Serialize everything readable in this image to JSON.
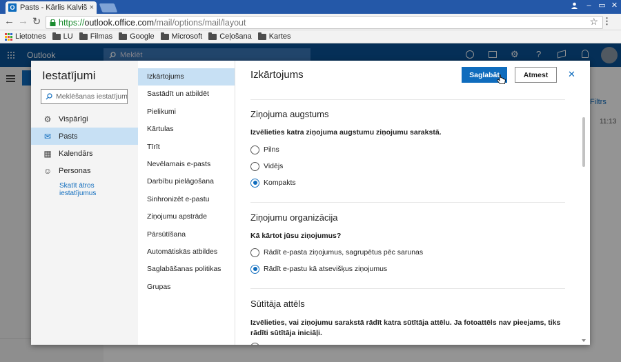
{
  "browser": {
    "tab_title": "Pasts - Kārlis Kalviški",
    "tab_close": "×",
    "url_scheme": "https://",
    "url_domain": "outlook.office.com",
    "url_path": "/mail/options/mail/layout",
    "back": "←",
    "forward": "→",
    "reload": "↻",
    "star": "☆",
    "menu": "⋮",
    "minimize": "–",
    "restore": "▭",
    "close": "✕",
    "lock": "🔒"
  },
  "bookmarks": [
    {
      "label": "Lietotnes",
      "icon": "apps-grid-icon"
    },
    {
      "label": "LU",
      "icon": "folder-icon"
    },
    {
      "label": "Filmas",
      "icon": "folder-icon"
    },
    {
      "label": "Google",
      "icon": "folder-icon"
    },
    {
      "label": "Microsoft",
      "icon": "folder-icon"
    },
    {
      "label": "Ceļošana",
      "icon": "folder-icon"
    },
    {
      "label": "Kartes",
      "icon": "folder-icon"
    }
  ],
  "outlook": {
    "app_name": "Outlook",
    "search_placeholder": "Meklēt",
    "filter_label": "Filtrs",
    "time": "11:13"
  },
  "settings": {
    "title": "Iestatījumi",
    "search_placeholder": "Meklēšanas iestatījumi",
    "nav": [
      {
        "label": "Vispārīgi",
        "icon": "gear-icon",
        "glyph": "⚙"
      },
      {
        "label": "Pasts",
        "icon": "mail-icon",
        "glyph": "✉"
      },
      {
        "label": "Kalendārs",
        "icon": "calendar-icon",
        "glyph": "▦"
      },
      {
        "label": "Personas",
        "icon": "people-icon",
        "glyph": "☺"
      }
    ],
    "quick_link": "Skatīt ātros iestatījumus",
    "categories": [
      "Izkārtojums",
      "Sastādīt un atbildēt",
      "Pielikumi",
      "Kārtulas",
      "Tīrīt",
      "Nevēlamais e-pasts",
      "Darbību pielāgošana",
      "Sinhronizēt e-pastu",
      "Ziņojumu apstrāde",
      "Pārsūtīšana",
      "Automātiskās atbildes",
      "Saglabāšanas politikas",
      "Grupas"
    ],
    "page_title": "Izkārtojums",
    "save_label": "Saglabāt",
    "discard_label": "Atmest",
    "close_glyph": "✕",
    "sections": {
      "height": {
        "title": "Ziņojuma augstums",
        "question": "Izvēlieties katra ziņojuma augstumu ziņojumu sarakstā.",
        "options": [
          "Pilns",
          "Vidējs",
          "Kompakts"
        ],
        "selected": "Kompakts"
      },
      "organization": {
        "title": "Ziņojumu organizācija",
        "question": "Kā kārtot jūsu ziņojumus?",
        "options": [
          "Rādīt e-pasta ziņojumus, sagrupētus pēc sarunas",
          "Rādīt e-pastu kā atsevišķus ziņojumus"
        ],
        "selected": "Rādīt e-pastu kā atsevišķus ziņojumus"
      },
      "sender_image": {
        "title": "Sūtītāja attēls",
        "question": "Izvēlieties, vai ziņojumu sarakstā rādīt katra sūtītāja attēlu. Ja fotoattēls nav pieejams, tiks rādīti sūtītāja iniciāļi."
      }
    }
  },
  "colors": {
    "accent": "#0f6cbd",
    "selected_bg": "#c7e0f4",
    "chrome_blue": "#2458a8",
    "outlook_blue": "#0a5196"
  }
}
